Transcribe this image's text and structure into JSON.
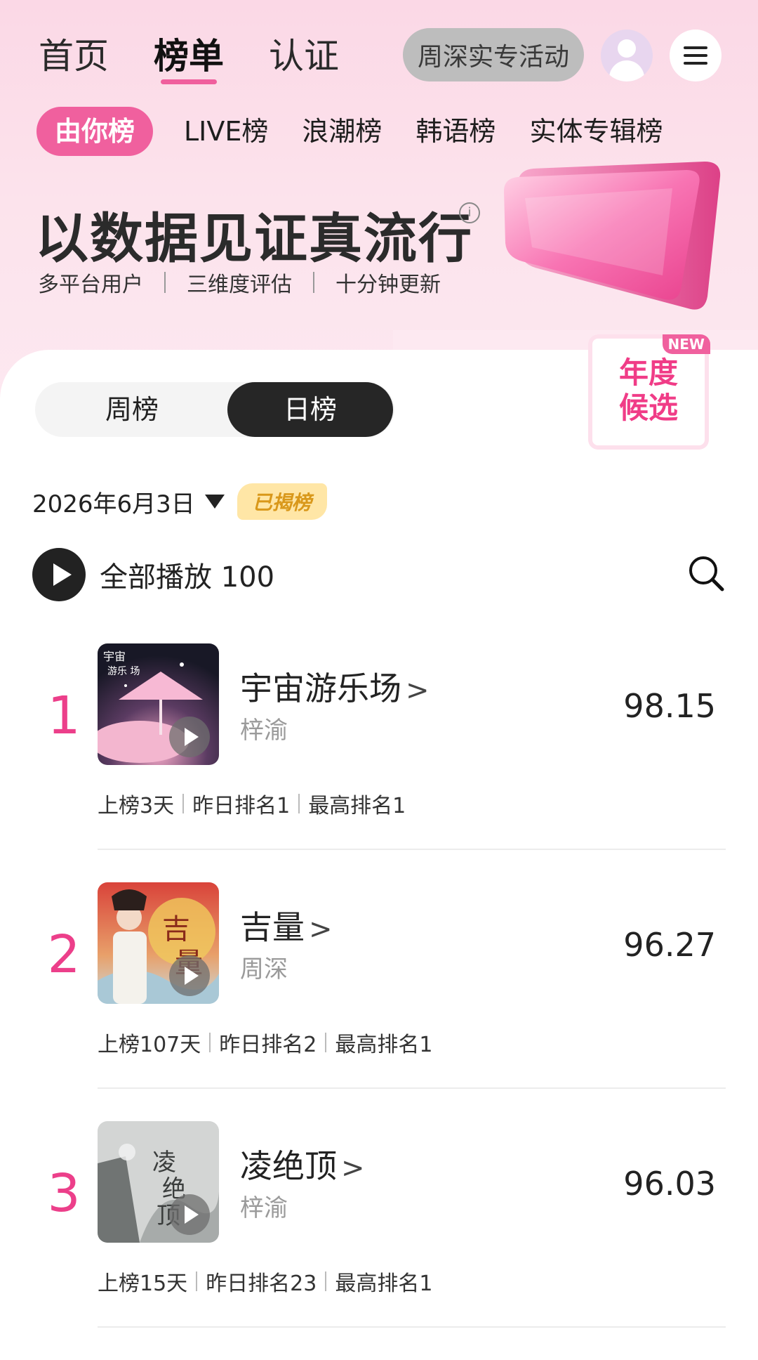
{
  "nav": {
    "items": [
      "首页",
      "榜单",
      "认证"
    ],
    "active_index": 1,
    "promo_label": "周深实专活动"
  },
  "subtabs": [
    "由你榜",
    "LIVE榜",
    "浪潮榜",
    "韩语榜",
    "实体专辑榜"
  ],
  "hero": {
    "slogan": "以数据见证真流行",
    "features": [
      "多平台用户",
      "三维度评估",
      "十分钟更新"
    ],
    "new_badge": "NEW",
    "annual_label_line1": "年度",
    "annual_label_line2": "候选"
  },
  "period_toggle": {
    "week": "周榜",
    "day": "日榜",
    "active": "day"
  },
  "date_row": {
    "date": "2026年6月3日",
    "status": "已揭榜"
  },
  "playall": {
    "label": "全部播放 100"
  },
  "chart": [
    {
      "rank": "1",
      "title": "宇宙游乐场",
      "artist": "梓渝",
      "score": "98.15",
      "days": "上榜3天",
      "yesterday": "昨日排名1",
      "best": "最高排名1",
      "cover_text": "宇宙游乐场",
      "cover_colors": [
        "#181826",
        "#f2a7c6"
      ]
    },
    {
      "rank": "2",
      "title": "吉量",
      "artist": "周深",
      "score": "96.27",
      "days": "上榜107天",
      "yesterday": "昨日排名2",
      "best": "最高排名1",
      "cover_text": "吉量",
      "cover_colors": [
        "#d9433a",
        "#f0c95c"
      ]
    },
    {
      "rank": "3",
      "title": "凌绝顶",
      "artist": "梓渝",
      "score": "96.03",
      "days": "上榜15天",
      "yesterday": "昨日排名23",
      "best": "最高排名1",
      "cover_text": "凌绝顶",
      "cover_colors": [
        "#c6c8c7",
        "#8e9291"
      ]
    }
  ],
  "colors": {
    "accent": "#f0609e",
    "rank": "#ec3f8a",
    "status_bg": "#ffe6a6",
    "status_fg": "#d9981a"
  }
}
